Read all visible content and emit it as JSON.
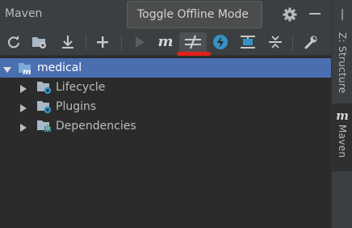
{
  "header": {
    "title": "Maven"
  },
  "tooltip": {
    "text": "Toggle Offline Mode"
  },
  "toolbar": {
    "items": [
      {
        "icon": "reload-icon"
      },
      {
        "icon": "generate-sources-icon"
      },
      {
        "icon": "download-icon"
      },
      {
        "icon": "add-icon"
      },
      {
        "icon": "run-icon"
      },
      {
        "icon": "execute-goal-icon",
        "glyph": "m"
      },
      {
        "icon": "toggle-offline-icon"
      },
      {
        "icon": "skip-tests-icon"
      },
      {
        "icon": "show-dependencies-icon"
      },
      {
        "icon": "collapse-all-icon"
      },
      {
        "icon": "settings-wrench-icon"
      }
    ]
  },
  "tree": {
    "root": {
      "label": "medical",
      "expanded": true,
      "selected": true
    },
    "children": [
      {
        "label": "Lifecycle",
        "icon": "folder-gear-icon"
      },
      {
        "label": "Plugins",
        "icon": "folder-gear-icon"
      },
      {
        "label": "Dependencies",
        "icon": "dependencies-icon"
      }
    ]
  },
  "sidebar": {
    "tabs": [
      {
        "label": "Z: Structure",
        "active": false
      },
      {
        "label": "Maven",
        "glyph": "m",
        "active": true
      }
    ]
  },
  "colors": {
    "panel": "#3c3f41",
    "background": "#2b2b2b",
    "selection": "#4b6eaf",
    "accent_blue": "#3592c4",
    "annotation_red": "#e0201a"
  }
}
